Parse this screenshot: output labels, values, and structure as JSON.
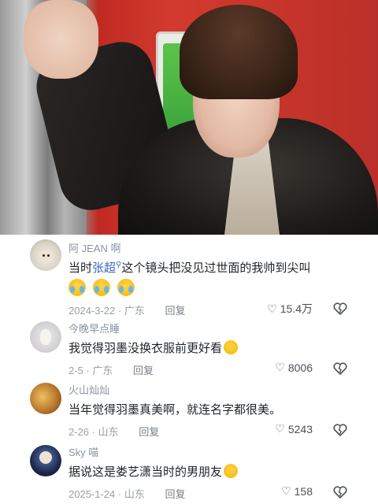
{
  "comments": [
    {
      "username": "阿 JEAN 啊",
      "text_before": "当时",
      "mention": "张超",
      "mention_icon": "search-icon",
      "text_after": "这个镜头把没见过世面的我帅到尖叫",
      "emojis": [
        "crying-laugh-emoji",
        "crying-laugh-emoji",
        "crying-laugh-emoji"
      ],
      "date": "2024-3-22",
      "location": "广东",
      "reply_label": "回复",
      "likes": "15.4万",
      "avatar_color": "#d9d2c4"
    },
    {
      "username": "今晚早点睡",
      "text": "我觉得羽墨没换衣服前更好看",
      "trailing_emoji": "wink-emoji",
      "date": "2-5",
      "location": "广东",
      "reply_label": "回复",
      "likes": "8006",
      "avatar_color": "#cfcfd2"
    },
    {
      "username": "火山灿灿",
      "text": "当年觉得羽墨真美啊，就连名字都很美。",
      "date": "2-26",
      "location": "山东",
      "reply_label": "回复",
      "likes": "5243",
      "avatar_color": "#b8792e"
    },
    {
      "username": "Sky 喵",
      "text": "据说这是娄艺潇当时的男朋友",
      "trailing_emoji": "smile-emoji",
      "date": "2025-1-24",
      "location": "山东",
      "reply_label": "回复",
      "likes": "158",
      "avatar_color": "#1f2a4a"
    }
  ],
  "icons": {
    "like": "heart-icon",
    "dislike": "broken-heart-icon"
  },
  "colors": {
    "username": "#8b93a0",
    "text": "#1f2329",
    "mention": "#3a67c7",
    "meta": "#9aa0a8"
  }
}
